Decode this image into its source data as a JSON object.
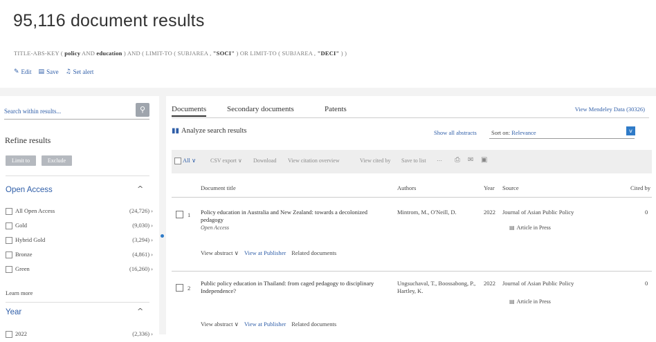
{
  "header": {
    "results_title": "95,116 document results",
    "query_prefix": "TITLE-ABS-KEY ( ",
    "query_term1": "policy",
    "query_and": " AND ",
    "query_term2": "education",
    "query_mid": " ) AND ( LIMIT-TO ( SUBJAREA , ",
    "query_val1": "\"SOCI\"",
    "query_or": " ) OR LIMIT-TO ( SUBJAREA , ",
    "query_val2": "\"DECI\"",
    "query_end": " ) )",
    "actions": {
      "edit": "Edit",
      "save": "Save",
      "set_alert": "Set alert"
    }
  },
  "sidebar": {
    "search_placeholder": "Search within results...",
    "refine_title": "Refine results",
    "limit_to": "Limit to",
    "exclude": "Exclude",
    "open_access": {
      "heading": "Open Access",
      "items": [
        {
          "label": "All Open Access",
          "count": "(24,726)"
        },
        {
          "label": "Gold",
          "count": "(9,030)"
        },
        {
          "label": "Hybrid Gold",
          "count": "(3,294)"
        },
        {
          "label": "Bronze",
          "count": "(4,861)"
        },
        {
          "label": "Green",
          "count": "(16,260)"
        }
      ],
      "learn_more": "Learn more"
    },
    "year": {
      "heading": "Year",
      "first_item_label": "2022",
      "first_item_count": "(2,336)"
    }
  },
  "tabs": {
    "documents": "Documents",
    "secondary": "Secondary documents",
    "patents": "Patents",
    "mendeley": "View Mendeley Data (30326)"
  },
  "results_bar": {
    "analyze": "Analyze search results",
    "show_all_abstracts": "Show all abstracts",
    "sort_on_label": "Sort on:",
    "sort_value": "Relevance"
  },
  "toolbar": {
    "all": "All",
    "csv_export": "CSV export",
    "download": "Download",
    "view_citation_overview": "View citation overview",
    "view_cited_by": "View cited by",
    "save_to_list": "Save to list",
    "more": "⋯"
  },
  "columns": {
    "document_title": "Document title",
    "authors": "Authors",
    "year": "Year",
    "source": "Source",
    "cited_by": "Cited by"
  },
  "rows": [
    {
      "num": "1",
      "title": "Policy education in Australia and New Zealand: towards a decolonized pedagogy",
      "open_access": "Open Access",
      "authors": "Mintrom, M., O'Neill, D.",
      "year": "2022",
      "source": "Journal of Asian Public Policy",
      "status": "Article in Press",
      "cited": "0",
      "view_abstract": "View abstract",
      "view_publisher": "View at Publisher",
      "related": "Related documents"
    },
    {
      "num": "2",
      "title": "Public policy education in Thailand: from caged pedagogy to disciplinary Independence?",
      "open_access": "",
      "authors": "Ungsuchaval, T., Boossabong, P., Hartley, K.",
      "year": "2022",
      "source": "Journal of Asian Public Policy",
      "status": "Article in Press",
      "cited": "0",
      "view_abstract": "View abstract",
      "view_publisher": "View at Publisher",
      "related": "Related documents"
    }
  ]
}
